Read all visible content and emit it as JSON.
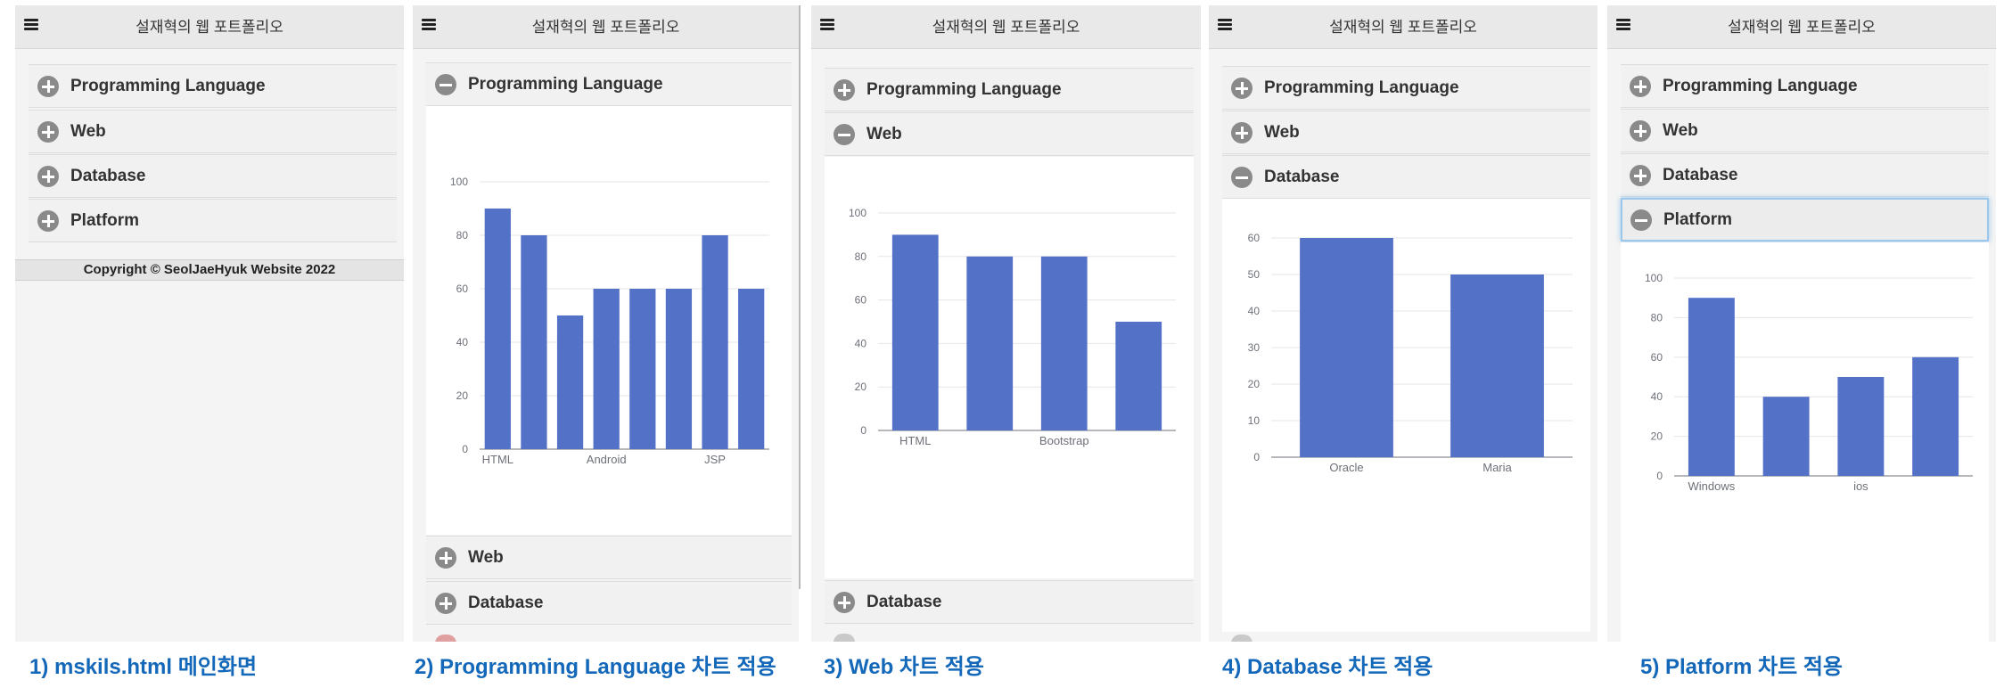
{
  "app": {
    "title": "설재혁의 웹 포트폴리오",
    "copyright": "Copyright © SeolJaeHyuk Website 2022"
  },
  "sections": {
    "programming": "Programming Language",
    "web": "Web",
    "database": "Database",
    "platform": "Platform"
  },
  "captions": [
    "1) mskils.html 메인화면",
    "2) Programming Language 차트 적용",
    "3) Web 차트 적용",
    "4) Database 차트 적용",
    "5) Platform 차트 적용"
  ],
  "colors": {
    "bar": "#5471c8",
    "accent": "#1468b9"
  },
  "icons": {
    "menu": "hamburger-icon",
    "expand": "plus-circle-icon",
    "collapse": "minus-circle-icon"
  },
  "chart_data": [
    {
      "type": "bar",
      "title": "",
      "categories": [
        "HTML",
        "",
        "",
        "Android",
        "",
        "",
        "JSP",
        ""
      ],
      "values": [
        90,
        80,
        50,
        60,
        60,
        60,
        80,
        60
      ],
      "ylim": [
        0,
        100
      ],
      "yticks": [
        0,
        20,
        40,
        60,
        80,
        100
      ],
      "grid": true
    },
    {
      "type": "bar",
      "title": "",
      "categories": [
        "HTML",
        "",
        "Bootstrap",
        ""
      ],
      "values": [
        90,
        80,
        80,
        50
      ],
      "ylim": [
        0,
        100
      ],
      "yticks": [
        0,
        20,
        40,
        60,
        80,
        100
      ],
      "grid": true
    },
    {
      "type": "bar",
      "title": "",
      "categories": [
        "Oracle",
        "Maria"
      ],
      "values": [
        60,
        50
      ],
      "ylim": [
        0,
        60
      ],
      "yticks": [
        0,
        10,
        20,
        30,
        40,
        50,
        60
      ],
      "grid": true
    },
    {
      "type": "bar",
      "title": "",
      "categories": [
        "Windows",
        "",
        "ios",
        ""
      ],
      "values": [
        90,
        40,
        50,
        60
      ],
      "ylim": [
        0,
        100
      ],
      "yticks": [
        0,
        20,
        40,
        60,
        80,
        100
      ],
      "grid": true
    }
  ]
}
